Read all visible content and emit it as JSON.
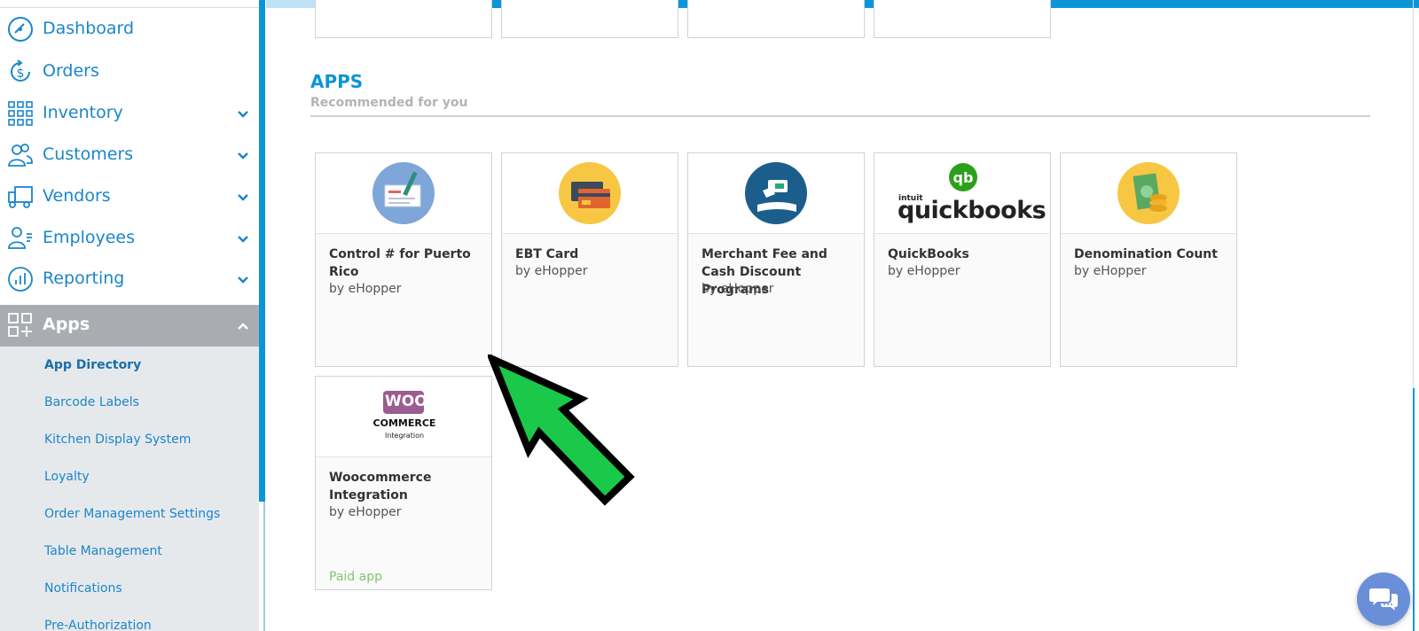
{
  "sidebar": {
    "items": [
      {
        "label": "Dashboard",
        "icon": "dashboard-icon"
      },
      {
        "label": "Orders",
        "icon": "orders-icon"
      },
      {
        "label": "Inventory",
        "icon": "inventory-icon"
      },
      {
        "label": "Customers",
        "icon": "customers-icon"
      },
      {
        "label": "Vendors",
        "icon": "vendors-icon"
      },
      {
        "label": "Employees",
        "icon": "employees-icon"
      },
      {
        "label": "Reporting",
        "icon": "reporting-icon"
      },
      {
        "label": "Apps",
        "icon": "apps-icon"
      }
    ],
    "sub_items": [
      {
        "label": "App Directory"
      },
      {
        "label": "Barcode Labels"
      },
      {
        "label": "Kitchen Display System"
      },
      {
        "label": "Loyalty"
      },
      {
        "label": "Order Management Settings"
      },
      {
        "label": "Table Management"
      },
      {
        "label": "Notifications"
      },
      {
        "label": "Pre-Authorization"
      }
    ]
  },
  "apps_section": {
    "title": "APPS",
    "subtitle": "Recommended for you"
  },
  "cards": [
    {
      "title": "Control # for Puerto Rico",
      "by": "by eHopper",
      "icon": "check-payment-icon"
    },
    {
      "title": "EBT Card",
      "by": "by eHopper",
      "icon": "ebt-card-icon"
    },
    {
      "title": "Merchant Fee and Cash Discount Programs",
      "by": "by eHopper",
      "icon": "merchant-fee-icon"
    },
    {
      "title": "QuickBooks",
      "by": "by eHopper",
      "icon": "quickbooks-logo",
      "logo_text": "quickbooks",
      "logo_small": "intuit"
    },
    {
      "title": "Denomination Count",
      "by": "by eHopper",
      "icon": "denomination-icon"
    },
    {
      "title": "Woocommerce Integration",
      "by": "by eHopper",
      "icon": "woocommerce-logo",
      "paid": "Paid app",
      "logo_top": "WOO",
      "logo_mid": "COMMERCE",
      "logo_bot": "Integration"
    }
  ],
  "colors": {
    "brand": "#0c95d6",
    "active_nav": "#a9adb2",
    "paid": "#7cc96d"
  }
}
